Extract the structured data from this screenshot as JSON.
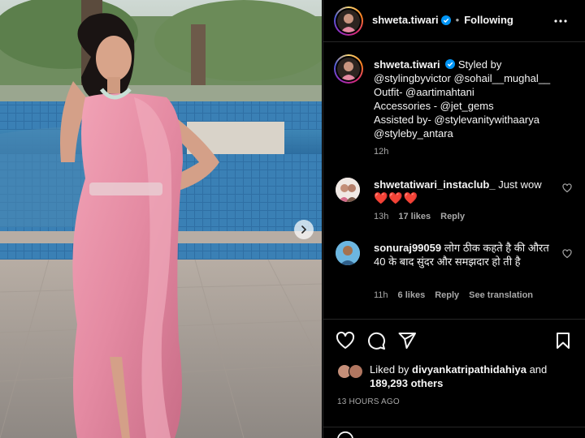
{
  "post": {
    "username": "shweta.tiwari",
    "follow_status": "Following",
    "separator": "•",
    "colors": {
      "accent_blue": "#0095f6",
      "heart_red": "#ff3040",
      "saree_pink": "#e98aa6"
    }
  },
  "caption": {
    "username": "shweta.tiwari",
    "lines": [
      "Styled by",
      "@stylingbyvictor @sohail__mughal__",
      "Outfit- @aartimahtani",
      "Accessories - @jet_gems",
      "Assisted by- @stylevanitywithaarya",
      "@styleby_antara"
    ],
    "time": "12h"
  },
  "comments": [
    {
      "username": "shwetatiwari_instaclub_",
      "text": "Just wow",
      "emoji": "❤️❤️❤️",
      "time": "13h",
      "likes": "17 likes",
      "reply": "Reply"
    },
    {
      "username": "sonuraj99059",
      "text": "लोग ठीक कहते है की औरत 40 के बाद सुंदर और समझदार हो ती है",
      "time": "11h",
      "likes": "6 likes",
      "reply": "Reply",
      "translate": "See translation"
    }
  ],
  "likes": {
    "prefix": "Liked by",
    "user": "divyankatripathidahiya",
    "and": "and",
    "count": "189,293 others"
  },
  "posted": "13 HOURS AGO",
  "icons": {
    "more": "more-icon",
    "next": "chevron-right-icon",
    "like": "heart-icon",
    "comment": "comment-icon",
    "share": "send-icon",
    "save": "bookmark-icon"
  }
}
